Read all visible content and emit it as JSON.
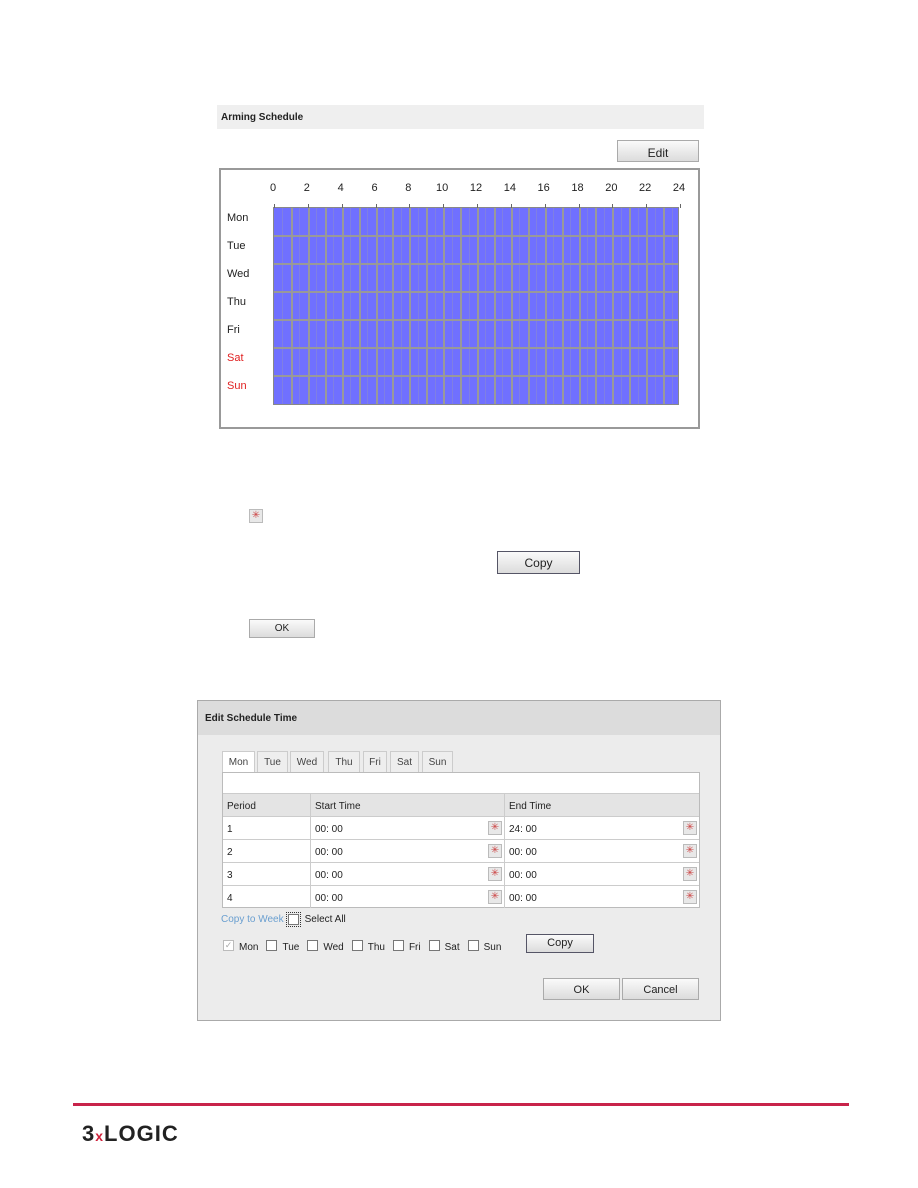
{
  "arming_schedule": {
    "title": "Arming Schedule",
    "edit_label": "Edit",
    "hours": [
      "0",
      "2",
      "4",
      "6",
      "8",
      "10",
      "12",
      "14",
      "16",
      "18",
      "20",
      "22",
      "24"
    ],
    "days": [
      {
        "label": "Mon",
        "weekend": false
      },
      {
        "label": "Tue",
        "weekend": false
      },
      {
        "label": "Wed",
        "weekend": false
      },
      {
        "label": "Thu",
        "weekend": false
      },
      {
        "label": "Fri",
        "weekend": false
      },
      {
        "label": "Sat",
        "weekend": true
      },
      {
        "label": "Sun",
        "weekend": true
      }
    ],
    "armed_fraction": 1.0,
    "fill_color": "#7070ff",
    "weekend_color": "#e02020"
  },
  "inline": {
    "copy_label": "Copy",
    "ok_label": "OK"
  },
  "dialog": {
    "title": "Edit Schedule Time",
    "tabs": [
      "Mon",
      "Tue",
      "Wed",
      "Thu",
      "Fri",
      "Sat",
      "Sun"
    ],
    "active_tab": "Mon",
    "columns": [
      "Period",
      "Start Time",
      "End Time"
    ],
    "rows": [
      {
        "period": "1",
        "start": "00: 00",
        "end": "24: 00"
      },
      {
        "period": "2",
        "start": "00: 00",
        "end": "00: 00"
      },
      {
        "period": "3",
        "start": "00: 00",
        "end": "00: 00"
      },
      {
        "period": "4",
        "start": "00: 00",
        "end": "00: 00"
      }
    ],
    "copy_to_week": "Copy to Week",
    "select_all": "Select All",
    "week_days": [
      {
        "label": "Mon",
        "checked": true
      },
      {
        "label": "Tue",
        "checked": false
      },
      {
        "label": "Wed",
        "checked": false
      },
      {
        "label": "Thu",
        "checked": false
      },
      {
        "label": "Fri",
        "checked": false
      },
      {
        "label": "Sat",
        "checked": false
      },
      {
        "label": "Sun",
        "checked": false
      }
    ],
    "copy_label": "Copy",
    "ok_label": "OK",
    "cancel_label": "Cancel"
  },
  "footer": {
    "logo": "3xLOGIC",
    "rule_color": "#c8234a"
  }
}
